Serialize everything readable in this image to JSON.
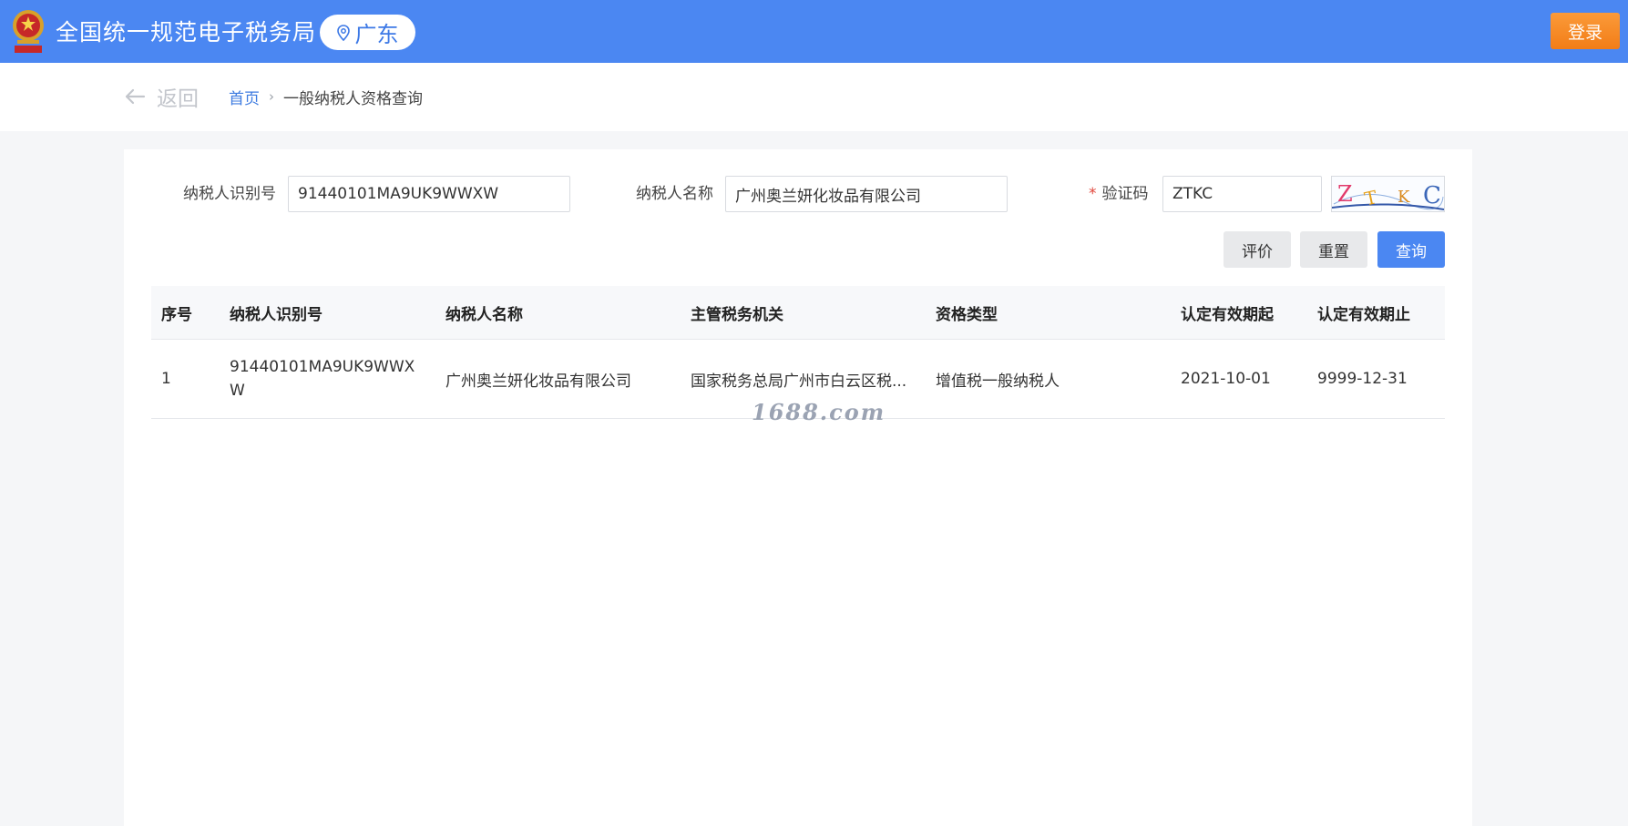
{
  "header": {
    "site_title": "全国统一规范电子税务局",
    "region": "广东",
    "login_label": "登录"
  },
  "breadcrumb": {
    "back_label": "返回",
    "home": "首页",
    "current": "一般纳税人资格查询"
  },
  "form": {
    "taxpayer_id_label": "纳税人识别号",
    "taxpayer_id_value": "91440101MA9UK9WWXW",
    "taxpayer_name_label": "纳税人名称",
    "taxpayer_name_value": "广州奥兰妍化妆品有限公司",
    "captcha_required_mark": "*",
    "captcha_label": "验证码",
    "captcha_value": "ZTKC",
    "captcha_image_text": "ZTKC",
    "evaluate_label": "评价",
    "reset_label": "重置",
    "query_label": "查询"
  },
  "table": {
    "headers": [
      "序号",
      "纳税人识别号",
      "纳税人名称",
      "主管税务机关",
      "资格类型",
      "认定有效期起",
      "认定有效期止"
    ],
    "rows": [
      [
        "1",
        "91440101MA9UK9WWXW",
        "广州奥兰妍化妆品有限公司",
        "国家税务总局广州市白云区税...",
        "增值税一般纳税人",
        "2021-10-01",
        "9999-12-31"
      ]
    ]
  },
  "watermark": "1688.com",
  "colors": {
    "header_bg": "#4b87f2",
    "login_bg": "#f5871f",
    "primary": "#4b87f2",
    "link": "#3d7be0",
    "required": "#e0463b"
  },
  "icons": {
    "emblem": "national-emblem-icon",
    "location": "location-pin-icon",
    "back": "arrow-left-icon"
  }
}
